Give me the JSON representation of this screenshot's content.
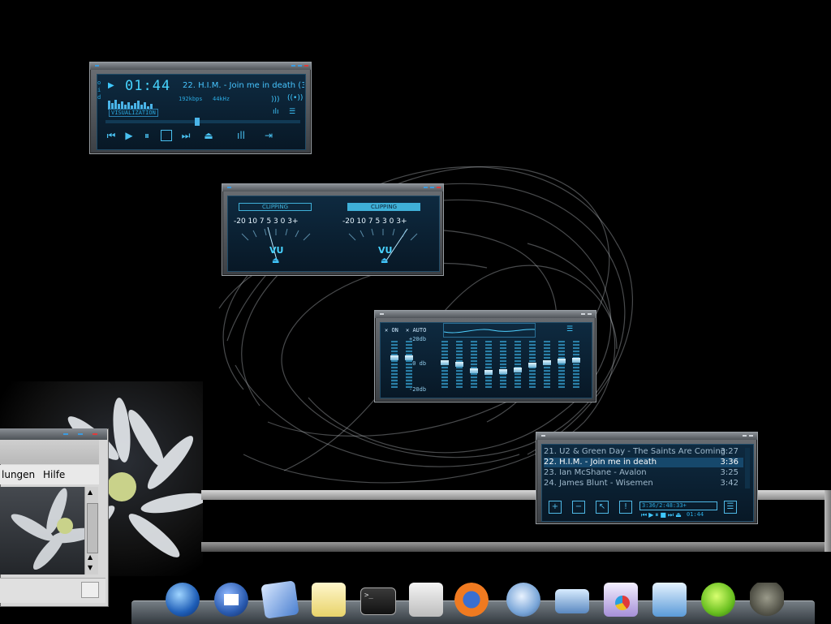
{
  "main_player": {
    "time": "01:44",
    "track_title": "22. H.I.M. - Join me in death (3:",
    "bitrate": "192kbps",
    "khz": "44kHz",
    "visualization_label": "VISUALIZATION"
  },
  "vu_meter": {
    "left_clip": "CLIPPING",
    "right_clip": "CLIPPING",
    "scale": "-20 10 7 5 3 0 3+",
    "left_label": "VU",
    "right_label": "VU"
  },
  "equalizer": {
    "on_label": "ON",
    "auto_label": "AUTO",
    "db_top": "+20db",
    "db_mid": "+0 db",
    "db_bottom": "-20db",
    "band_levels": [
      0.5,
      0.5,
      0.38,
      0.35,
      0.2,
      0.15,
      0.18,
      0.22,
      0.33,
      0.38,
      0.42,
      0.45
    ]
  },
  "playlist": {
    "items": [
      {
        "title": "21. U2 & Green Day - The Saints Are Coming",
        "duration": "3:27"
      },
      {
        "title": "22. H.I.M. - Join me in death",
        "duration": "3:36"
      },
      {
        "title": "23. Ian McShane - Avalon",
        "duration": "3:25"
      },
      {
        "title": "24. James Blunt - Wisemen",
        "duration": "3:42"
      }
    ],
    "active_index": 1,
    "total_time": "3:36/2:48:33+",
    "mini_time": "01:44",
    "buttons": [
      "+",
      "−",
      "↖",
      "!"
    ]
  },
  "file_manager": {
    "menu_left": "lungen",
    "menu_help": "Hilfe"
  },
  "dock": {
    "icons": [
      "globe-icon",
      "home-icon",
      "mail-icon",
      "notepad-icon",
      "terminal-icon",
      "settings-icon",
      "firefox-icon",
      "itunes-icon",
      "network-icon",
      "presentation-icon",
      "word-icon",
      "limewire-icon",
      "gimp-icon"
    ]
  },
  "colors": {
    "accent": "#3fc8ff",
    "lcd_bg": "#0b2234",
    "highlight": "#16486c"
  }
}
